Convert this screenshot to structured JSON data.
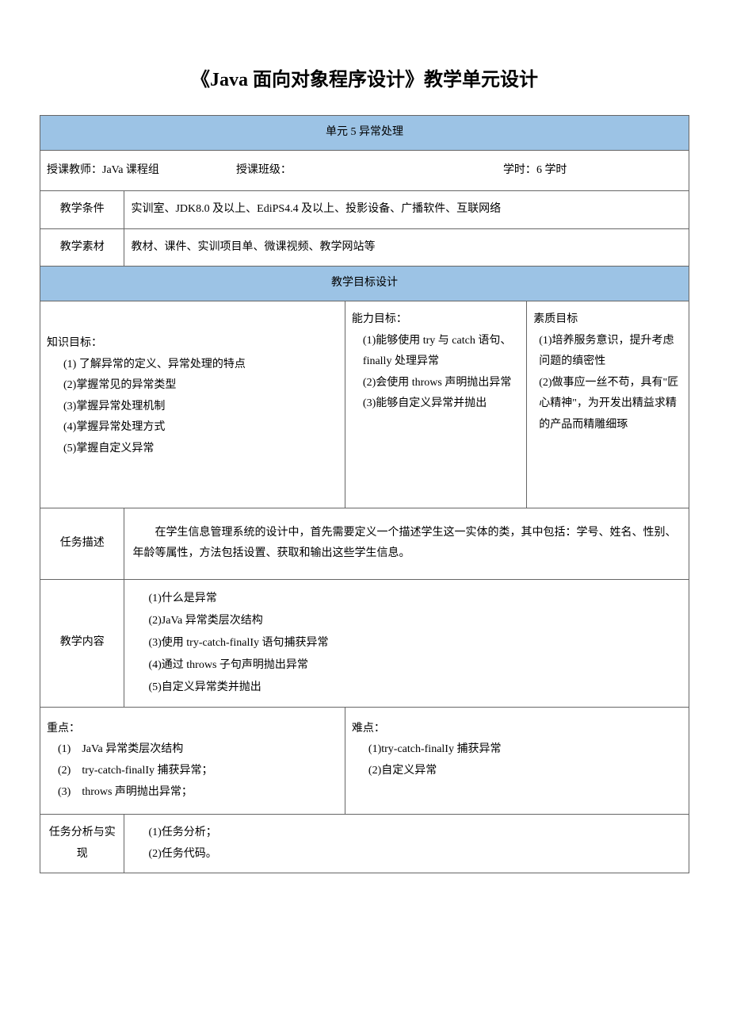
{
  "title": "《Java 面向对象程序设计》教学单元设计",
  "unit_header": "单元 5 异常处理",
  "meta": {
    "teacher_label": "授课教师：",
    "teacher_value": "JaVa 课程组",
    "class_label": "授课班级：",
    "class_value": "",
    "hours_label": "学时：",
    "hours_value": "6 学时"
  },
  "conditions": {
    "label": "教学条件",
    "value": "实训室、JDK8.0 及以上、EdiPS4.4 及以上、投影设备、广播软件、互联网络"
  },
  "materials": {
    "label": "教学素材",
    "value": "教材、课件、实训项目单、微课视频、教学网站等"
  },
  "goals_header": "教学目标设计",
  "knowledge_goals": {
    "title": "知识目标：",
    "items": [
      "(1) 了解异常的定义、异常处理的特点",
      "(2)掌握常见的异常类型",
      "(3)掌握异常处理机制",
      "(4)掌握异常处理方式",
      "(5)掌握自定义异常"
    ]
  },
  "ability_goals": {
    "title": "能力目标：",
    "items": [
      "(1)能够使用 try 与 catch 语句、finally 处理异常",
      "(2)会使用 throws 声明抛出异常",
      "(3)能够自定义异常并抛出"
    ]
  },
  "quality_goals": {
    "title": "素质目标",
    "items": [
      "(1)培养服务意识，提升考虑问题的缜密性",
      "(2)做事应一丝不苟，具有\"匠心精神\"，为开发出精益求精的产品而精雕细琢"
    ]
  },
  "task_desc": {
    "label": "任务描述",
    "value": "在学生信息管理系统的设计中，首先需要定义一个描述学生这一实体的类，其中包括：学号、姓名、性别、年龄等属性，方法包括设置、获取和输出这些学生信息。"
  },
  "teach_content": {
    "label": "教学内容",
    "items": [
      "(1)什么是异常",
      "(2)JaVa 异常类层次结构",
      "(3)使用 try-catch-finalIy 语句捕获异常",
      "(4)通过 throws 子句声明抛出异常",
      "(5)自定义异常类并抛出"
    ]
  },
  "key_points": {
    "title": "重点：",
    "items": [
      "(1)　JaVa 异常类层次结构",
      "(2)　try-catch-finalIy 捕获异常；",
      "(3)　throws 声明抛出异常；"
    ]
  },
  "difficulties": {
    "title": "难点：",
    "items": [
      "(1)try-catch-finalIy 捕获异常",
      "(2)自定义异常"
    ]
  },
  "task_analysis": {
    "label": "任务分析与实现",
    "items": [
      "(1)任务分析；",
      "(2)任务代码。"
    ]
  }
}
